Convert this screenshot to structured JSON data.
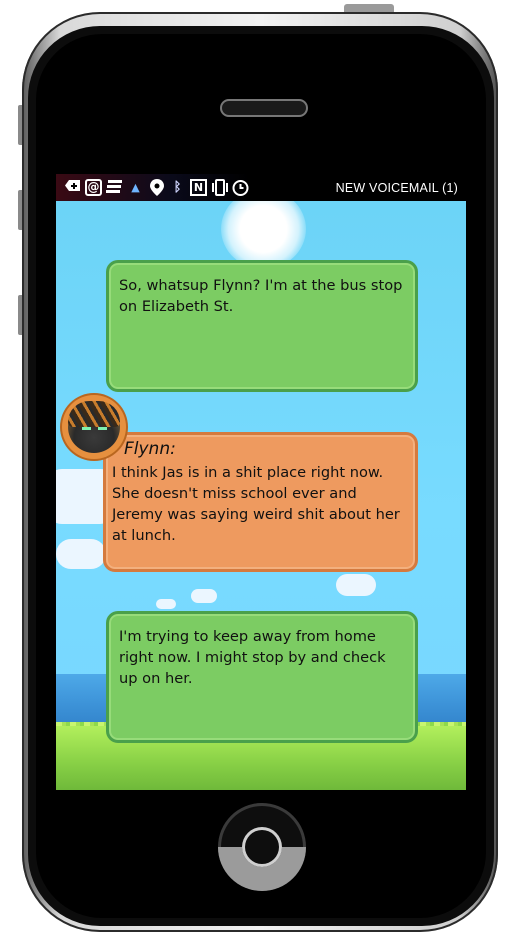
{
  "statusbar": {
    "icons": [
      "battery-plus-icon",
      "at-sign-icon",
      "stacked-lines-icon",
      "signal-icon",
      "location-pin-icon",
      "bluetooth-icon",
      "nfc-icon",
      "phone-vibrate-icon",
      "alarm-clock-icon"
    ],
    "right_text": "NEW VOICEMAIL (1)"
  },
  "messages": [
    {
      "side": "right",
      "color": "#7ccc63",
      "text": "So, whatsup Flynn? I'm at the bus stop on Elizabeth St."
    },
    {
      "side": "left",
      "color": "#ee9a5f",
      "name": "Flynn:",
      "text": "I think Jas is in a shit place right now. She doesn't miss school ever and Jeremy was saying weird shit about her at lunch."
    },
    {
      "side": "right",
      "color": "#7ccc63",
      "text": "I'm trying to keep away from home right now. I might stop by and check up on her."
    }
  ]
}
